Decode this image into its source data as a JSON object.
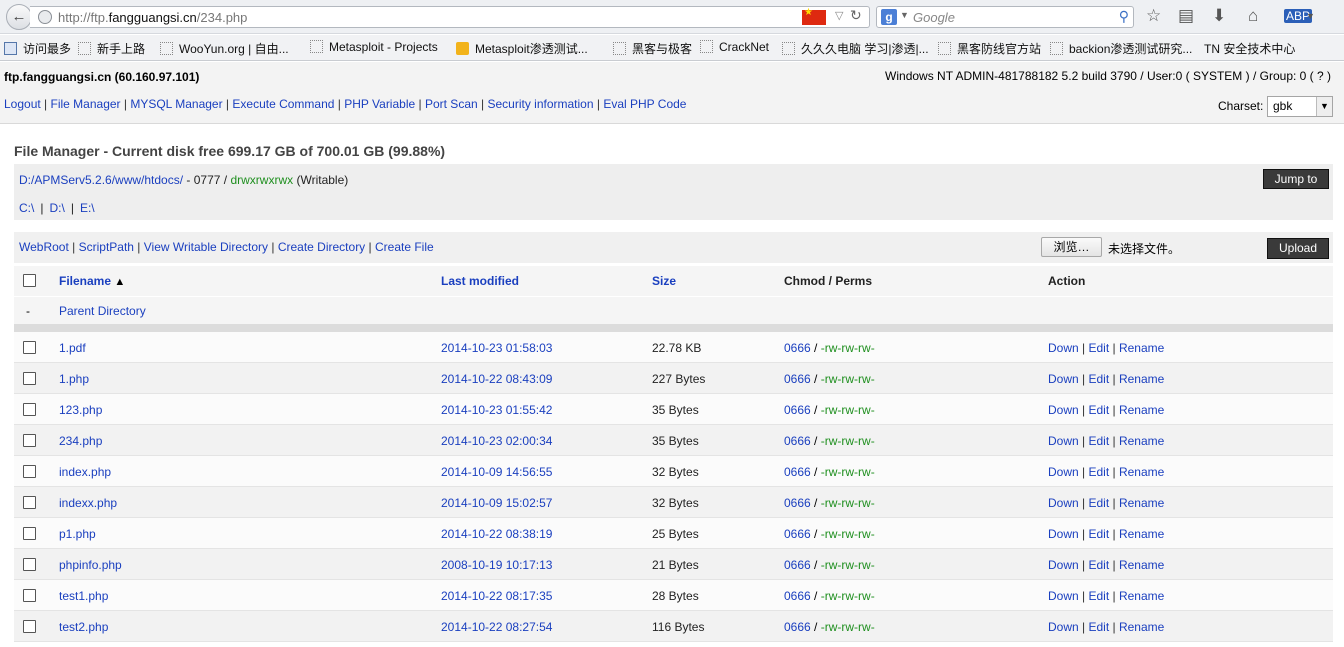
{
  "browser": {
    "url_prefix": "http://ftp.",
    "url_domain": "fangguangsi.cn",
    "url_path": "/234.php",
    "search_placeholder": "Google",
    "search_engine_letter": "g",
    "bookmarks": [
      "访问最多",
      "新手上路",
      "WooYun.org | 自由...",
      "Metasploit - Projects",
      "Metasploit渗透测试...",
      "黑客与极客",
      "CrackNet",
      "久久久电脑 学习|渗透|...",
      "黑客防线官方站",
      "backion渗透测试研究...",
      "TN 安全技术中心"
    ]
  },
  "header": {
    "host": "ftp.fangguangsi.cn (60.160.97.101)",
    "sysinfo": "Windows NT ADMIN-481788182 5.2 build 3790 / User:0 ( SYSTEM ) / Group: 0 ( ? )",
    "nav": [
      "Logout",
      "File Manager",
      "MYSQL Manager",
      "Execute Command",
      "PHP Variable",
      "Port Scan",
      "Security information",
      "Eval PHP Code"
    ],
    "charset_label": "Charset:",
    "charset_value": "gbk"
  },
  "file_manager": {
    "title": "File Manager - Current disk free 699.17 GB of 700.01 GB (99.88%)",
    "path": "D:/APMServ5.2.6/www/htdocs/",
    "path_mode": "0777",
    "path_perms": "drwxrwxrwx",
    "path_writable": "(Writable)",
    "drives": [
      "C:\\",
      "D:\\",
      "E:\\"
    ],
    "jump_label": "Jump to",
    "action_links": [
      "WebRoot",
      "ScriptPath",
      "View Writable Directory",
      "Create Directory",
      "Create File"
    ],
    "browse_label": "浏览…",
    "no_file_text": "未选择文件。",
    "upload_label": "Upload",
    "columns": {
      "filename": "Filename",
      "sort_indicator": "▲",
      "last_modified": "Last modified",
      "size": "Size",
      "chmod": "Chmod / Perms",
      "action": "Action"
    },
    "parent": {
      "dash": "-",
      "label": "Parent Directory"
    },
    "action_labels": {
      "down": "Down",
      "edit": "Edit",
      "rename": "Rename"
    },
    "files": [
      {
        "name": "1.pdf",
        "modified": "2014-10-23 01:58:03",
        "size": "22.78 KB",
        "chmod": "0666",
        "perms": "-rw-rw-rw-"
      },
      {
        "name": "1.php",
        "modified": "2014-10-22 08:43:09",
        "size": "227 Bytes",
        "chmod": "0666",
        "perms": "-rw-rw-rw-"
      },
      {
        "name": "123.php",
        "modified": "2014-10-23 01:55:42",
        "size": "35 Bytes",
        "chmod": "0666",
        "perms": "-rw-rw-rw-"
      },
      {
        "name": "234.php",
        "modified": "2014-10-23 02:00:34",
        "size": "35 Bytes",
        "chmod": "0666",
        "perms": "-rw-rw-rw-"
      },
      {
        "name": "index.php",
        "modified": "2014-10-09 14:56:55",
        "size": "32 Bytes",
        "chmod": "0666",
        "perms": "-rw-rw-rw-"
      },
      {
        "name": "indexx.php",
        "modified": "2014-10-09 15:02:57",
        "size": "32 Bytes",
        "chmod": "0666",
        "perms": "-rw-rw-rw-"
      },
      {
        "name": "p1.php",
        "modified": "2014-10-22 08:38:19",
        "size": "25 Bytes",
        "chmod": "0666",
        "perms": "-rw-rw-rw-"
      },
      {
        "name": "phpinfo.php",
        "modified": "2008-10-19 10:17:13",
        "size": "21 Bytes",
        "chmod": "0666",
        "perms": "-rw-rw-rw-"
      },
      {
        "name": "test1.php",
        "modified": "2014-10-22 08:17:35",
        "size": "28 Bytes",
        "chmod": "0666",
        "perms": "-rw-rw-rw-"
      },
      {
        "name": "test2.php",
        "modified": "2014-10-22 08:27:54",
        "size": "116 Bytes",
        "chmod": "0666",
        "perms": "-rw-rw-rw-"
      }
    ]
  },
  "colors": {
    "link": "#1a3fbf",
    "perms_green": "#1f8f1f",
    "button_dark": "#3a3a3a"
  }
}
